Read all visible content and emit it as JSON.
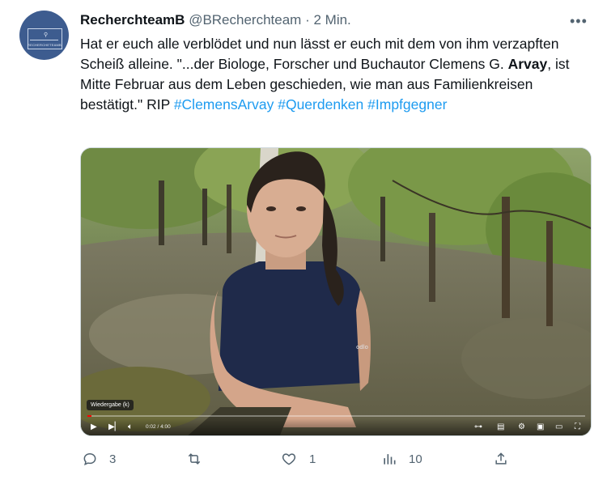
{
  "tweet": {
    "author_name": "RecherchteamB",
    "author_handle": "@BRecherchteam",
    "separator": "·",
    "time": "2 Min.",
    "avatar_text": "RECHERCHETEAMB",
    "text_part1": "Hat er euch alle verblödet und nun lässt er euch mit dem von ihm verzapften Scheiß alleine. \"...der Biologe, Forscher und Buchautor Clemens G. ",
    "text_bold": "Arvay",
    "text_part2": ", ist Mitte Februar aus dem Leben geschieden, wie man aus Familienkreisen bestätigt.\" RIP ",
    "hashtags": [
      "#ClemensArvay",
      "#Querdenken",
      "#Impfgegner"
    ]
  },
  "video": {
    "tooltip": "Wiedergabe (k)",
    "timecode": "0:02 / 4:00",
    "progress": 0.008,
    "shirt_logo_text": "odlo"
  },
  "actions": {
    "replies": "3",
    "retweets": "",
    "likes": "1",
    "views": "10"
  },
  "icons": [
    "more-icon",
    "reply-icon",
    "retweet-icon",
    "like-icon",
    "views-icon",
    "share-icon",
    "play-icon",
    "next-icon",
    "volume-icon",
    "autoplay-icon",
    "subtitles-icon",
    "settings-icon",
    "miniplayer-icon",
    "theater-icon",
    "fullscreen-icon"
  ],
  "colors": {
    "hashtag": "#1d9bf0",
    "secondary": "#536471",
    "progress": "#ff0000"
  }
}
